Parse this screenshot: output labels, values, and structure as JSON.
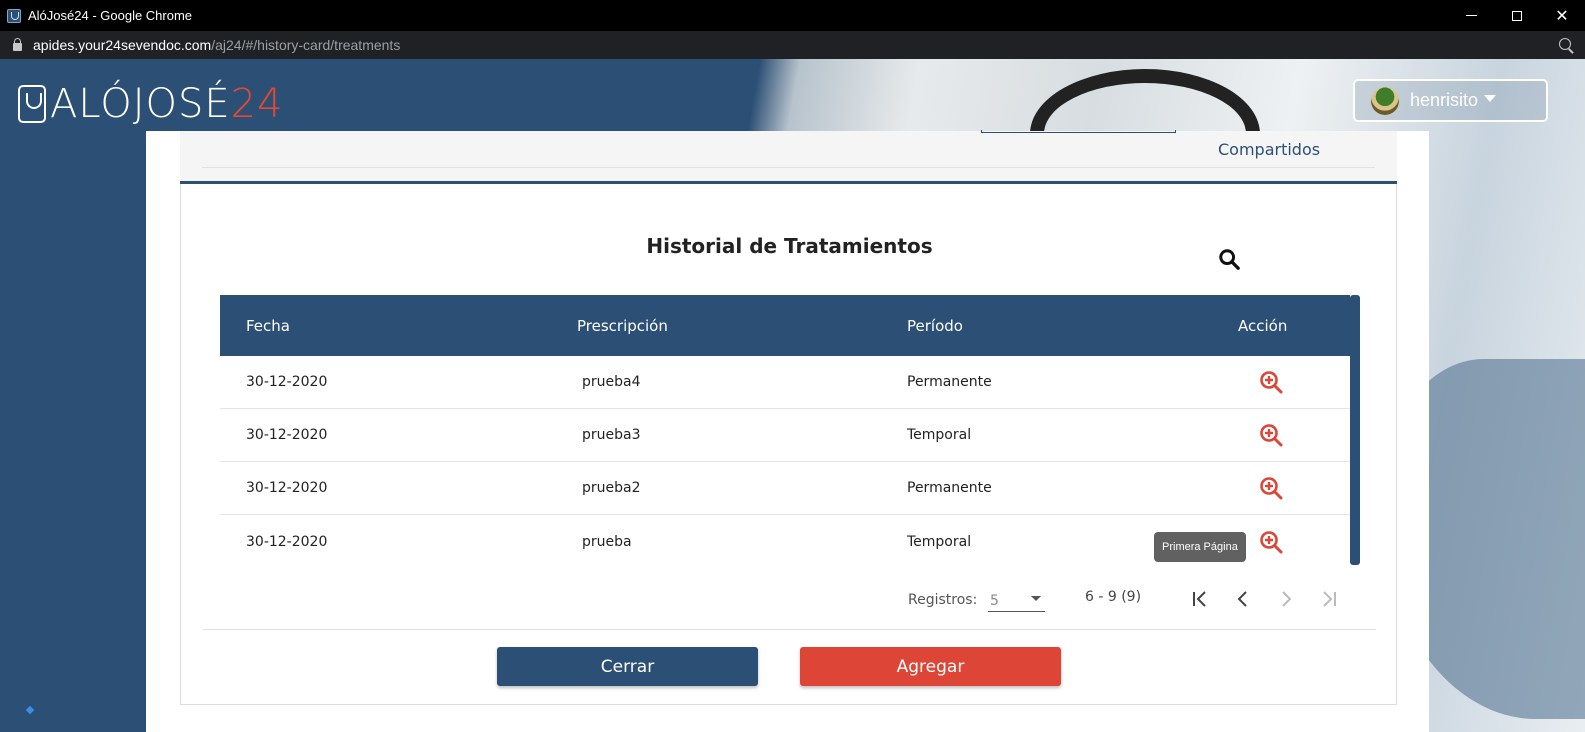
{
  "browser": {
    "tab_title": "AlóJosé24 - Google Chrome",
    "url_host": "apides.your24sevendoc.com",
    "url_path": "/aj24/#/history-card/treatments",
    "controls": {
      "minimize": "",
      "maximize": "",
      "close": "✕"
    }
  },
  "header": {
    "logo_main": "ALÓJOSÉ",
    "logo_num": "24",
    "user_name": "henrisito"
  },
  "modal": {
    "tab_label": "Compartidos",
    "title": "Historial de Tratamientos",
    "table": {
      "columns": [
        "Fecha",
        "Prescripción",
        "Período",
        "Acción"
      ],
      "rows": [
        {
          "fecha": "30-12-2020",
          "prescripcion": "prueba4",
          "periodo": "Permanente"
        },
        {
          "fecha": "30-12-2020",
          "prescripcion": "prueba3",
          "periodo": "Temporal"
        },
        {
          "fecha": "30-12-2020",
          "prescripcion": "prueba2",
          "periodo": "Permanente"
        },
        {
          "fecha": "30-12-2020",
          "prescripcion": "prueba",
          "periodo": "Temporal"
        }
      ]
    },
    "tooltip": "Primera Página",
    "pager": {
      "label": "Registros:",
      "page_size": "5",
      "range": "6 - 9 (9)"
    },
    "buttons": {
      "close": "Cerrar",
      "add": "Agregar"
    }
  },
  "colors": {
    "primary": "#2c4f75",
    "accent": "#dd4536"
  },
  "icons": [
    "search-icon",
    "zoom-plus-icon",
    "first-page-icon",
    "prev-page-icon",
    "next-page-icon",
    "last-page-icon",
    "chevron-down-icon",
    "lock-icon"
  ]
}
